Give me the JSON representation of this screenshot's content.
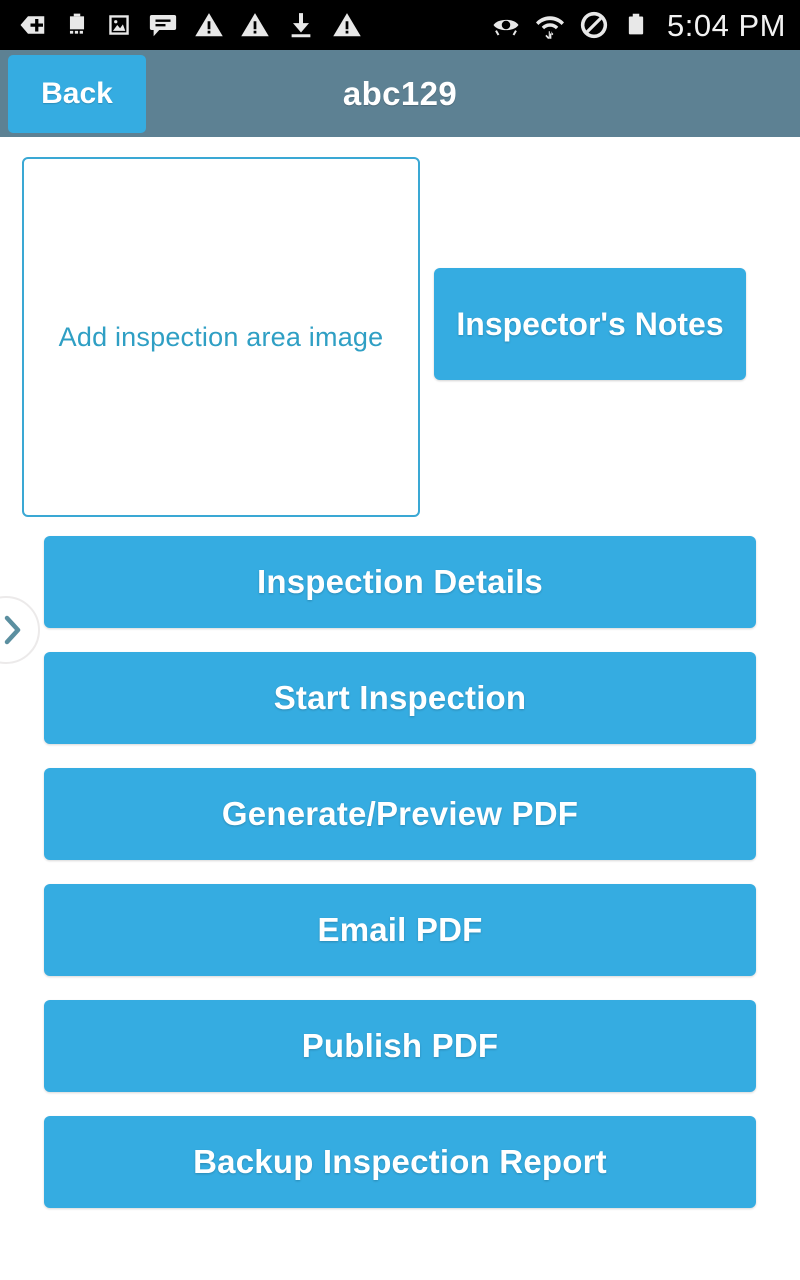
{
  "statusbar": {
    "time": "5:04 PM",
    "left_icons": [
      {
        "name": "back-arrow-plus-icon",
        "label": "back-plus"
      },
      {
        "name": "battery-saver-icon",
        "label": "battery-00"
      },
      {
        "name": "image-icon",
        "label": "screenshot"
      },
      {
        "name": "message-icon",
        "label": "sms"
      },
      {
        "name": "warning-icon",
        "label": "alert-1"
      },
      {
        "name": "warning-icon",
        "label": "alert-2"
      },
      {
        "name": "download-icon",
        "label": "download"
      },
      {
        "name": "warning-icon",
        "label": "alert-3"
      }
    ],
    "right_icons": [
      {
        "name": "eye-icon",
        "label": "smart-stay"
      },
      {
        "name": "wifi-icon",
        "label": "wifi-transfer"
      },
      {
        "name": "do-not-disturb-icon",
        "label": "mute"
      },
      {
        "name": "battery-icon",
        "label": "battery-full"
      }
    ]
  },
  "header": {
    "back_label": "Back",
    "title": "abc129"
  },
  "main": {
    "image_placeholder": {
      "label": "Add inspection area image"
    },
    "notes_button": {
      "label": "Inspector's Notes"
    },
    "actions": [
      {
        "label": "Inspection Details"
      },
      {
        "label": "Start Inspection"
      },
      {
        "label": "Generate/Preview PDF"
      },
      {
        "label": "Email PDF"
      },
      {
        "label": "Publish PDF"
      },
      {
        "label": "Backup Inspection Report"
      }
    ],
    "drawer_handle": {
      "icon": "chevron-right-icon"
    }
  },
  "colors": {
    "accent_blue": "#35ACE1",
    "header_slate": "#5D8193",
    "placeholder_text": "#2F9FC4",
    "statusbar_black": "#000000",
    "page_background": "#FFFFFF"
  }
}
